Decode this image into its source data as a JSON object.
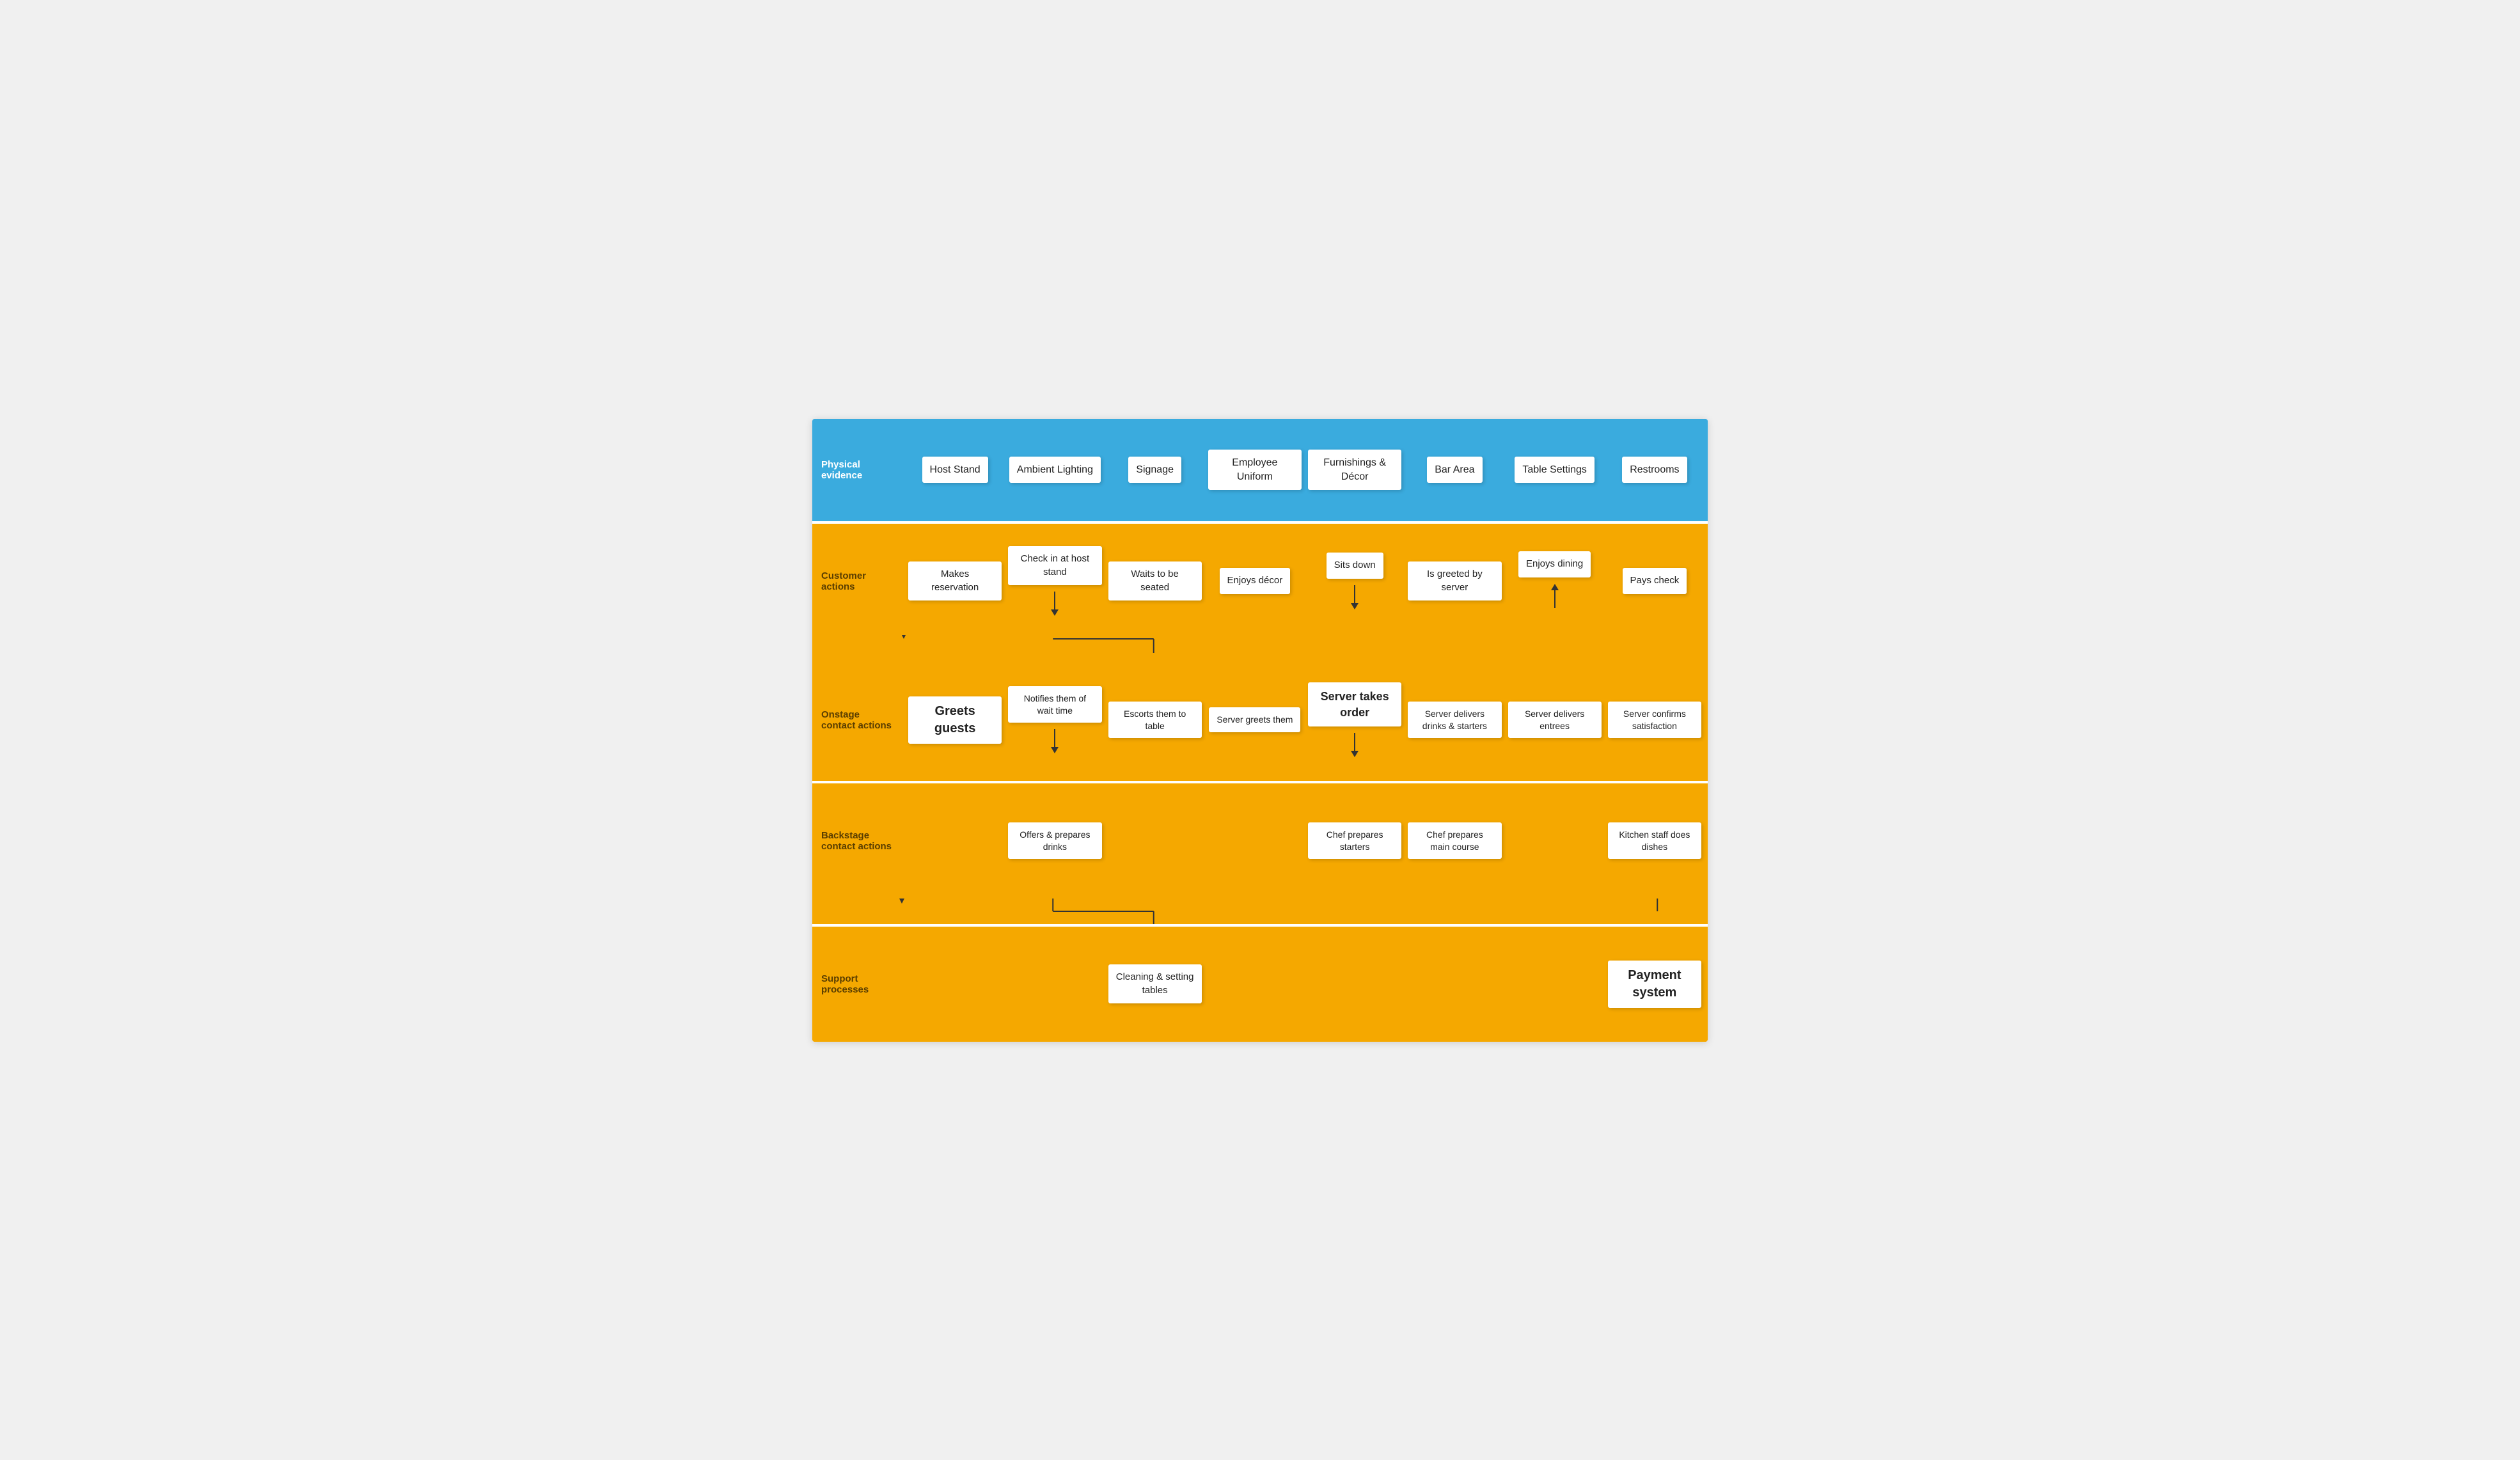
{
  "rows": {
    "physical": {
      "label": "Physical evidence",
      "cards": [
        "Host Stand",
        "Ambient Lighting",
        "Signage",
        "Employee Uniform",
        "Furnishings & Décor",
        "Bar Area",
        "Table Settings",
        "Restrooms"
      ]
    },
    "customer": {
      "label": "Customer actions",
      "cards": [
        "Makes reservation",
        "Check in at host stand",
        "Waits to be seated",
        "Enjoys décor",
        "Sits down",
        "Is greeted by server",
        "Enjoys dining",
        "Pays check"
      ]
    },
    "onstage": {
      "label": "Onstage contact actions",
      "cards": [
        "Greets guests",
        "Notifies them of wait time",
        "Escorts them to table",
        "Server greets them",
        "Server takes order",
        "Server delivers drinks & starters",
        "Server delivers entrees",
        "Server confirms satisfaction"
      ]
    },
    "backstage": {
      "label": "Backstage contact actions",
      "cards": {
        "col2": "Offers & prepares drinks",
        "col5": "Chef prepares starters",
        "col6": "Chef prepares main course",
        "col8": "Kitchen staff does dishes"
      }
    },
    "support": {
      "label": "Support processes",
      "cards": {
        "col3": "Cleaning & setting tables",
        "col8": "Payment system"
      }
    }
  },
  "colors": {
    "blue": "#3aabde",
    "amber": "#f5a800",
    "white": "#ffffff",
    "text_dark": "#333333",
    "label_dark": "#5a3e00"
  }
}
